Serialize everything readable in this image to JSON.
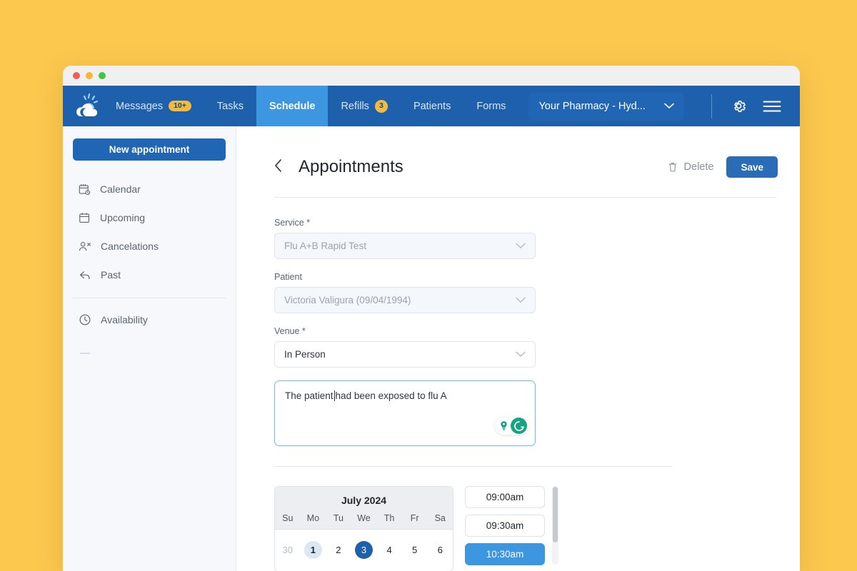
{
  "window": {
    "traffic_lights": [
      "close",
      "minimize",
      "maximize"
    ]
  },
  "navbar": {
    "logo": "cloud-sun-logo",
    "items": [
      {
        "label": "Messages",
        "badge": "10+",
        "active": false
      },
      {
        "label": "Tasks",
        "badge": "",
        "active": false
      },
      {
        "label": "Schedule",
        "badge": "",
        "active": true
      },
      {
        "label": "Refills",
        "badge": "3",
        "active": false
      },
      {
        "label": "Patients",
        "badge": "",
        "active": false
      },
      {
        "label": "Forms",
        "badge": "",
        "active": false
      }
    ],
    "pharmacy_selector": "Your Pharmacy - Hyd...",
    "settings_icon": "gear-icon",
    "menu_icon": "hamburger-icon",
    "accent": "#3d96e0",
    "bar_color": "#1f60ad",
    "badge_color": "#f2bb3f"
  },
  "sidebar": {
    "new_appointment_label": "New appointment",
    "items": [
      {
        "label": "Calendar",
        "icon": "calendar-clock-icon"
      },
      {
        "label": "Upcoming",
        "icon": "calendar-icon"
      },
      {
        "label": "Cancelations",
        "icon": "person-remove-icon"
      },
      {
        "label": "Past",
        "icon": "arrow-back-icon"
      }
    ],
    "secondary_items": [
      {
        "label": "Availability",
        "icon": "clock-icon"
      }
    ]
  },
  "page": {
    "back_icon": "chevron-left-icon",
    "title": "Appointments",
    "delete_label": "Delete",
    "delete_icon": "trash-icon",
    "save_label": "Save"
  },
  "form": {
    "service": {
      "label": "Service *",
      "value": "Flu A+B Rapid Test",
      "disabled": true
    },
    "patient": {
      "label": "Patient",
      "value": "Victoria Valigura (09/04/1994)",
      "disabled": true
    },
    "venue": {
      "label": "Venue *",
      "value": "In Person",
      "disabled": false
    },
    "notes": {
      "text_before_caret": "The patient",
      "text_after_caret": "had been exposed to flu A",
      "focused": true,
      "assistant_icons": [
        "lightbulb-icon",
        "grammarly-g-icon"
      ]
    }
  },
  "picker": {
    "calendar": {
      "month": "July 2024",
      "dow": [
        "Su",
        "Mo",
        "Tu",
        "We",
        "Th",
        "Fr",
        "Sa"
      ],
      "week": [
        {
          "day": "30",
          "state": "muted"
        },
        {
          "day": "1",
          "state": "today"
        },
        {
          "day": "2",
          "state": "normal"
        },
        {
          "day": "3",
          "state": "selected"
        },
        {
          "day": "4",
          "state": "normal"
        },
        {
          "day": "5",
          "state": "normal"
        },
        {
          "day": "6",
          "state": "normal"
        }
      ]
    },
    "slots": [
      {
        "time": "09:00am",
        "selected": false
      },
      {
        "time": "09:30am",
        "selected": false
      },
      {
        "time": "10:30am",
        "selected": true
      }
    ]
  }
}
